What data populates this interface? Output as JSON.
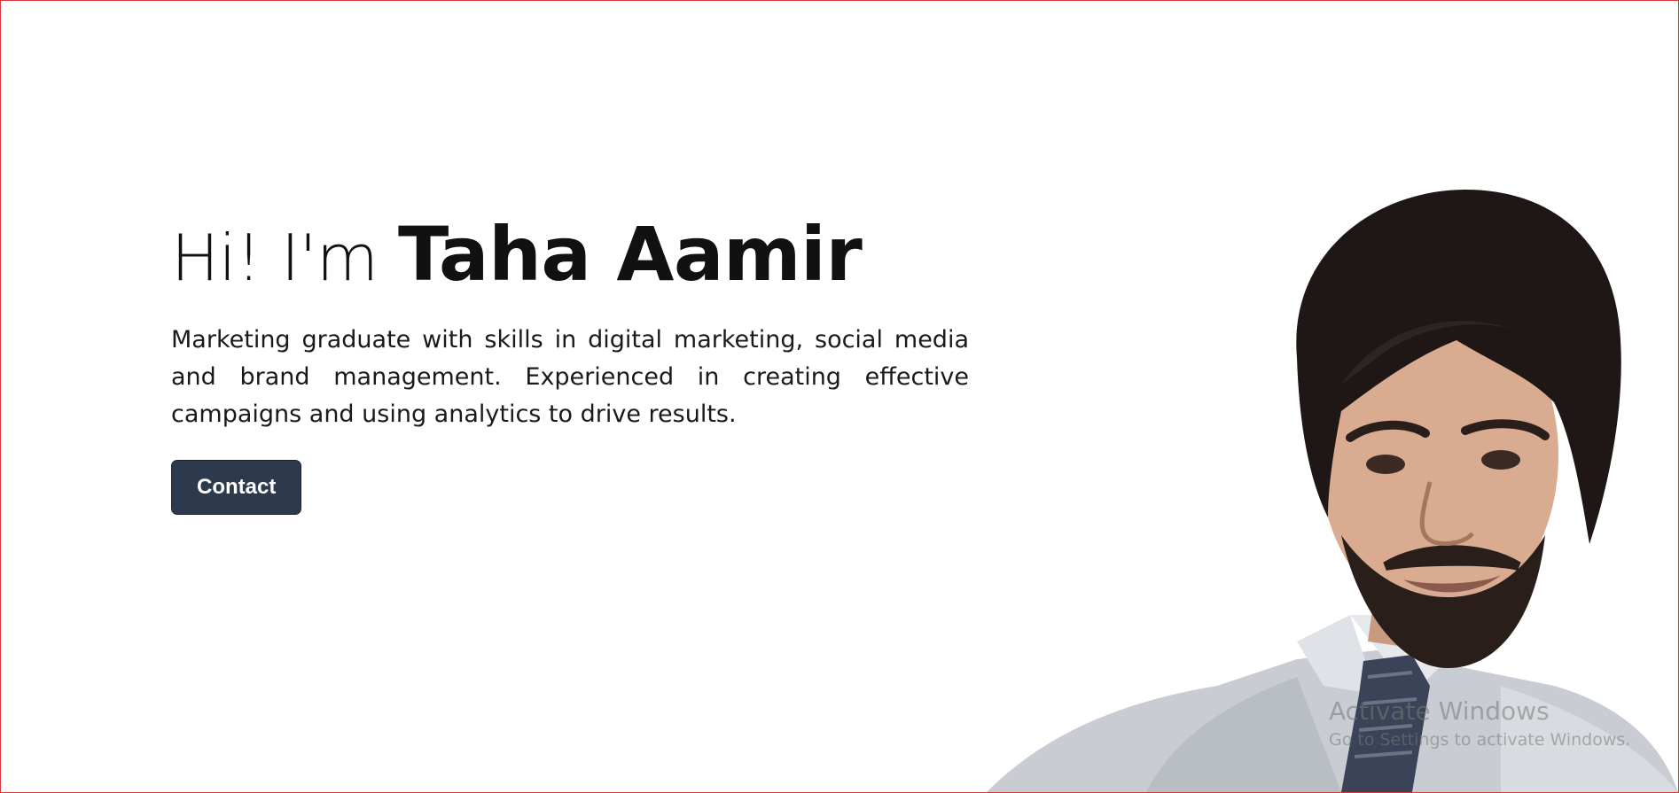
{
  "hero": {
    "greeting": "Hi! I'm",
    "name": "Taha Aamir",
    "bio": "Marketing graduate with skills in digital marketing, social media and brand management. Experienced in creating effective campaigns and using analytics to drive results.",
    "contact_label": "Contact"
  },
  "watermark": {
    "title": "Activate Windows",
    "subtitle": "Go to Settings to activate Windows."
  },
  "colors": {
    "button_bg": "#2d3a4e",
    "page_border": "#d9363e"
  }
}
